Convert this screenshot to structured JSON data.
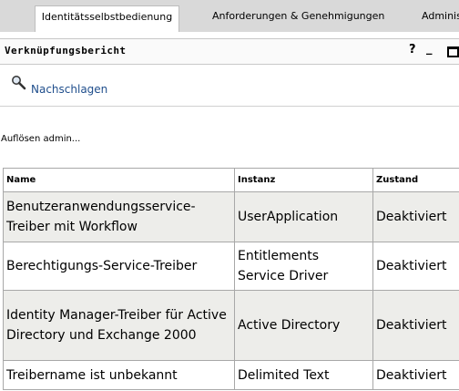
{
  "tabs": [
    {
      "label": "Identitätsselbstbedienung",
      "active": true
    },
    {
      "label": "Anforderungen & Genehmigungen",
      "active": false
    },
    {
      "label": "Administr",
      "active": false
    }
  ],
  "portlet": {
    "title": "Verknüpfungsbericht",
    "help_symbol": "?",
    "minimize_symbol": "_"
  },
  "lookup": {
    "label": "Nachschlagen",
    "icon": "magnifier-icon"
  },
  "status": "Auflösen admin...",
  "table": {
    "headers": [
      "Name",
      "Instanz",
      "Zustand"
    ],
    "rows": [
      {
        "name": "Benutzeranwendungsservice-Treiber mit Workflow",
        "instance": "UserApplication",
        "state": "Deaktiviert"
      },
      {
        "name": "Berechtigungs-Service-Treiber",
        "instance": "Entitlements Service Driver",
        "state": "Deaktiviert"
      },
      {
        "name": "Identity Manager-Treiber für Active Directory und Exchange 2000",
        "instance": "Active Directory",
        "state": "Deaktiviert"
      },
      {
        "name": "Treibername ist unbekannt",
        "instance": "Delimited Text",
        "state": "Deaktiviert"
      }
    ]
  },
  "colors": {
    "tabbar": "#d9d9d9",
    "link": "#1f4e8c",
    "alt_row": "#ededea",
    "border": "#a8a8a8"
  }
}
